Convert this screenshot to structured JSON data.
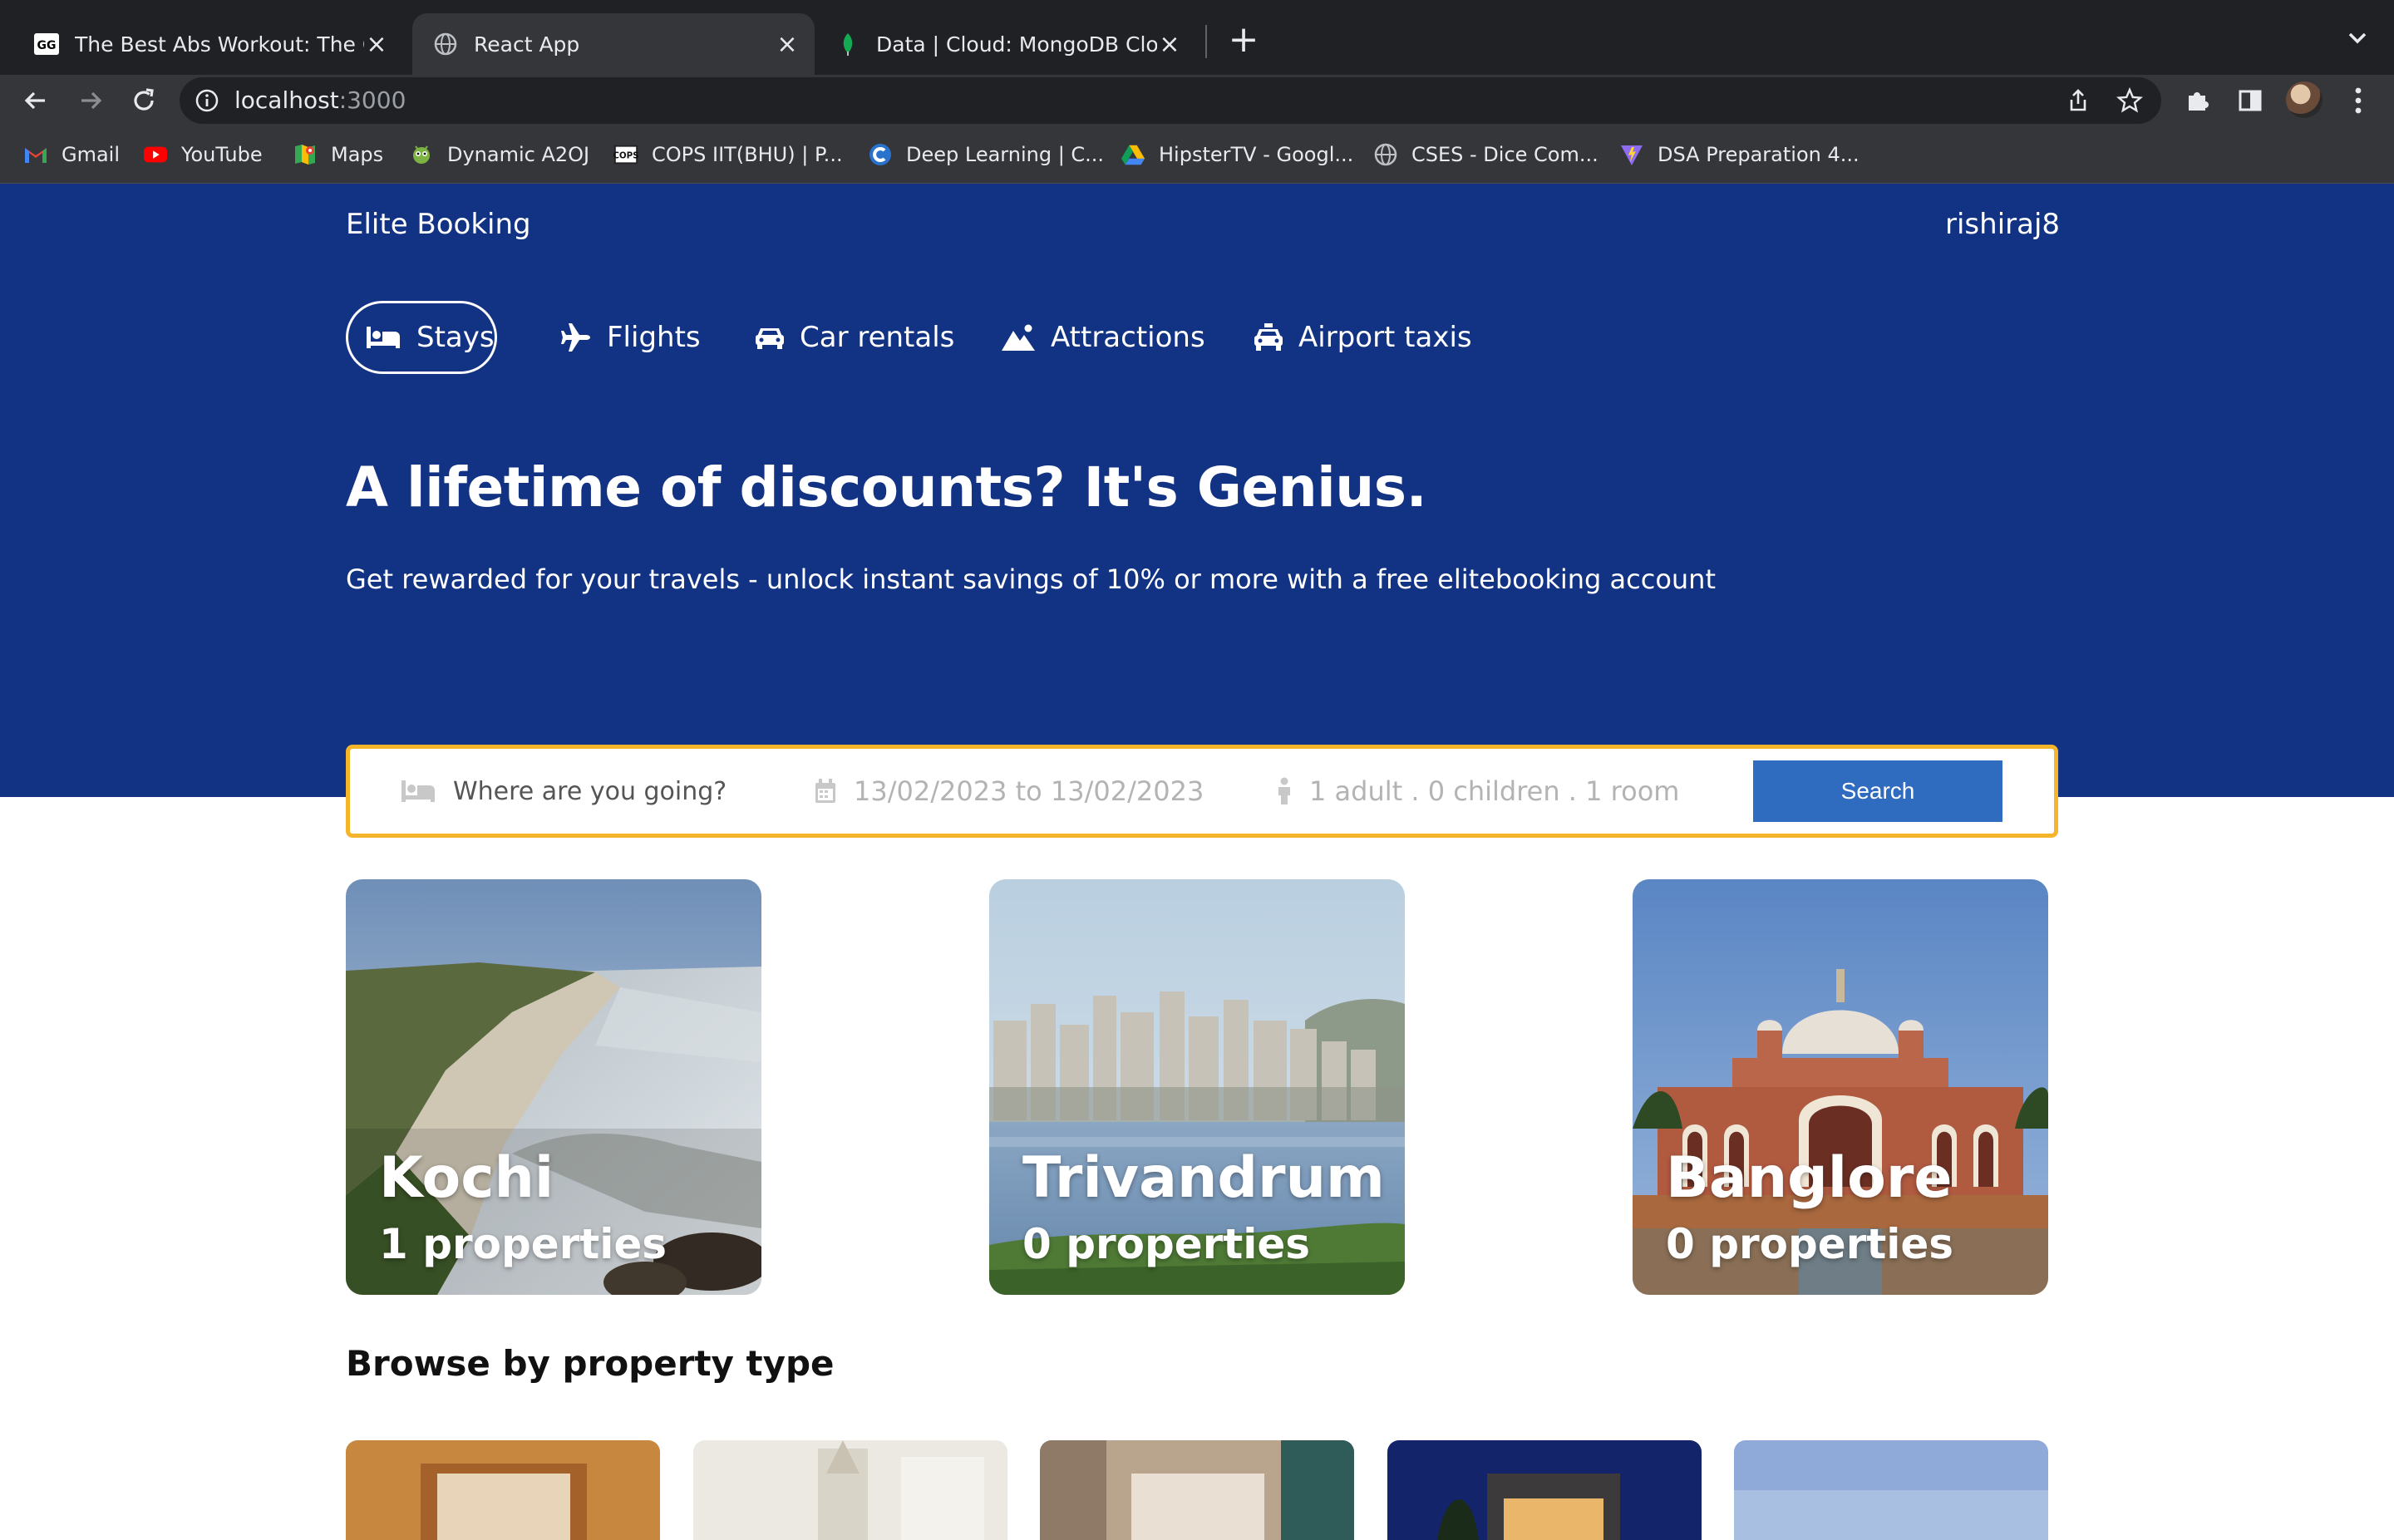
{
  "browser": {
    "tabs": [
      {
        "title": "The Best Abs Workout: The On",
        "favicon": "site-logo-icon",
        "active": false
      },
      {
        "title": "React App",
        "favicon": "globe-icon",
        "active": true
      },
      {
        "title": "Data | Cloud: MongoDB Cloud",
        "favicon": "mongodb-leaf-icon",
        "active": false
      }
    ],
    "new_tab": "+",
    "tab_close": "×",
    "url_host": "localhost",
    "url_port": ":3000",
    "bookmarks": [
      {
        "label": "Gmail",
        "icon": "gmail-icon"
      },
      {
        "label": "YouTube",
        "icon": "youtube-icon"
      },
      {
        "label": "Maps",
        "icon": "maps-icon"
      },
      {
        "label": "Dynamic A2OJ",
        "icon": "a2oj-icon"
      },
      {
        "label": "COPS IIT(BHU) | P...",
        "icon": "cops-icon"
      },
      {
        "label": "Deep Learning | C...",
        "icon": "coursera-icon"
      },
      {
        "label": "HipsterTV - Googl...",
        "icon": "google-drive-icon"
      },
      {
        "label": "CSES - Dice Com...",
        "icon": "globe-icon"
      },
      {
        "label": "DSA Preparation 4...",
        "icon": "vite-icon"
      }
    ]
  },
  "header": {
    "logo": "Elite Booking",
    "username": "rishiraj8"
  },
  "nav": {
    "items": [
      {
        "label": "Stays",
        "icon": "bed-icon",
        "active": true
      },
      {
        "label": "Flights",
        "icon": "plane-icon",
        "active": false
      },
      {
        "label": "Car rentals",
        "icon": "car-icon",
        "active": false
      },
      {
        "label": "Attractions",
        "icon": "mountain-icon",
        "active": false
      },
      {
        "label": "Airport taxis",
        "icon": "taxi-icon",
        "active": false
      }
    ]
  },
  "hero": {
    "headline": "A lifetime of discounts? It's Genius.",
    "subline": "Get rewarded for your travels - unlock instant savings of 10% or more with a free elitebooking account"
  },
  "search": {
    "destination_placeholder": "Where are you going?",
    "dates": "13/02/2023 to 13/02/2023",
    "guests": "1 adult . 0 children . 1 room",
    "button": "Search"
  },
  "featured": [
    {
      "city": "Kochi",
      "properties": "1 properties"
    },
    {
      "city": "Trivandrum",
      "properties": "0 properties"
    },
    {
      "city": "Banglore",
      "properties": "0 properties"
    }
  ],
  "property_types": {
    "title": "Browse by property type"
  },
  "colors": {
    "hero_bg": "#123383",
    "search_border": "#f4b52b",
    "search_button": "#2f6bbf"
  }
}
